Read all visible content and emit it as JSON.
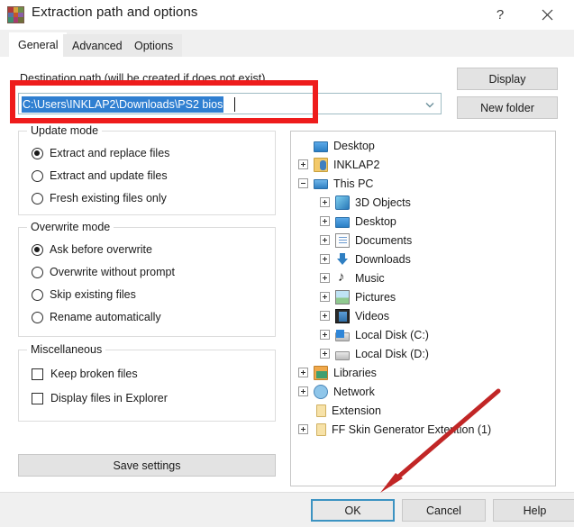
{
  "window": {
    "title": "Extraction path and options",
    "app_icon": "winrar-books-icon",
    "help_button": "?",
    "close_button": "✕"
  },
  "tabs": [
    {
      "label": "General",
      "active": true
    },
    {
      "label": "Advanced",
      "active": false
    },
    {
      "label": "Options",
      "active": false
    }
  ],
  "destination": {
    "label": "Destination path (will be created if does not exist)",
    "value": "C:\\Users\\INKLAP2\\Downloads\\PS2 bios",
    "selected": true,
    "dropdown_icon": "chevron-down-icon"
  },
  "side_buttons": {
    "display": "Display",
    "new_folder": "New folder"
  },
  "update_mode": {
    "title": "Update mode",
    "options": [
      {
        "label": "Extract and replace files",
        "checked": true
      },
      {
        "label": "Extract and update files",
        "checked": false
      },
      {
        "label": "Fresh existing files only",
        "checked": false
      }
    ]
  },
  "overwrite_mode": {
    "title": "Overwrite mode",
    "options": [
      {
        "label": "Ask before overwrite",
        "checked": true
      },
      {
        "label": "Overwrite without prompt",
        "checked": false
      },
      {
        "label": "Skip existing files",
        "checked": false
      },
      {
        "label": "Rename automatically",
        "checked": false
      }
    ]
  },
  "miscellaneous": {
    "title": "Miscellaneous",
    "options": [
      {
        "label": "Keep broken files",
        "checked": false
      },
      {
        "label": "Display files in Explorer",
        "checked": false
      }
    ]
  },
  "save_settings_label": "Save settings",
  "tree": [
    {
      "label": "Desktop",
      "indent": 0,
      "expander": "none",
      "icon": "monitor-icon"
    },
    {
      "label": "INKLAP2",
      "indent": 1,
      "expander": "plus",
      "icon": "user-folder-icon"
    },
    {
      "label": "This PC",
      "indent": 1,
      "expander": "minus",
      "icon": "pc-icon"
    },
    {
      "label": "3D Objects",
      "indent": 2,
      "expander": "plus",
      "icon": "3d-objects-icon"
    },
    {
      "label": "Desktop",
      "indent": 2,
      "expander": "plus",
      "icon": "monitor-icon"
    },
    {
      "label": "Documents",
      "indent": 2,
      "expander": "plus",
      "icon": "documents-icon"
    },
    {
      "label": "Downloads",
      "indent": 2,
      "expander": "plus",
      "icon": "downloads-icon"
    },
    {
      "label": "Music",
      "indent": 2,
      "expander": "plus",
      "icon": "music-icon"
    },
    {
      "label": "Pictures",
      "indent": 2,
      "expander": "plus",
      "icon": "pictures-icon"
    },
    {
      "label": "Videos",
      "indent": 2,
      "expander": "plus",
      "icon": "videos-icon"
    },
    {
      "label": "Local Disk (C:)",
      "indent": 2,
      "expander": "plus",
      "icon": "disk-c-icon"
    },
    {
      "label": "Local Disk (D:)",
      "indent": 2,
      "expander": "plus",
      "icon": "disk-d-icon"
    },
    {
      "label": "Libraries",
      "indent": 1,
      "expander": "plus",
      "icon": "libraries-icon"
    },
    {
      "label": "Network",
      "indent": 1,
      "expander": "plus",
      "icon": "network-icon"
    },
    {
      "label": "Extension",
      "indent": 1,
      "expander": "none",
      "icon": "folder-icon"
    },
    {
      "label": "FF Skin Generator Extention (1)",
      "indent": 1,
      "expander": "plus",
      "icon": "folder-icon"
    }
  ],
  "footer": {
    "ok": "OK",
    "cancel": "Cancel",
    "help": "Help"
  },
  "annotations": {
    "highlight_color": "#ee1c1c",
    "arrow_color": "#c12626",
    "rect_target": "destination-path-combobox",
    "arrow_target": "ok-button"
  }
}
